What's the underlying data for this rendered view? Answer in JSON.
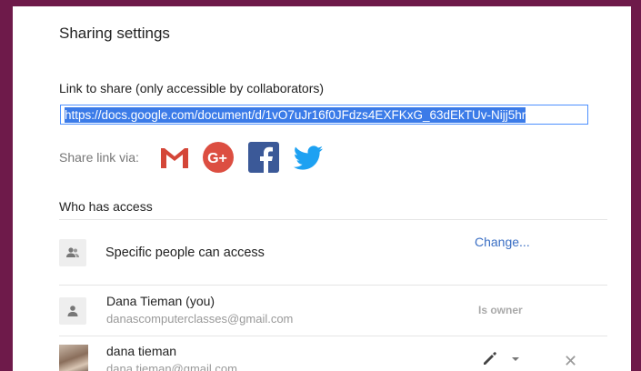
{
  "dialog": {
    "title": "Sharing settings"
  },
  "link": {
    "label": "Link to share (only accessible by collaborators)",
    "url": "https://docs.google.com/document/d/1vO7uJr16f0JFdzs4EXFKxG_63dEkTUv-Nijj5hr"
  },
  "share_via": {
    "label": "Share link via:",
    "services": [
      {
        "name": "Gmail",
        "icon": "gmail-icon",
        "color": "#d44638"
      },
      {
        "name": "Google+",
        "icon": "google-plus-icon",
        "color": "#dc4e41"
      },
      {
        "name": "Facebook",
        "icon": "facebook-icon",
        "color": "#3b5998"
      },
      {
        "name": "Twitter",
        "icon": "twitter-icon",
        "color": "#1da1f2"
      }
    ]
  },
  "access": {
    "section_label": "Who has access",
    "level_text": "Specific people can access",
    "change_label": "Change...",
    "people": [
      {
        "name": "Dana Tieman (you)",
        "email": "danascomputerclasses@gmail.com",
        "role": "Is owner"
      },
      {
        "name": "dana tieman",
        "email": "dana.tieman@gmail.com"
      }
    ]
  },
  "colors": {
    "frame": "#6e1a4a",
    "link_highlight": "#3b7be8",
    "link_color": "#3b6fc4"
  }
}
